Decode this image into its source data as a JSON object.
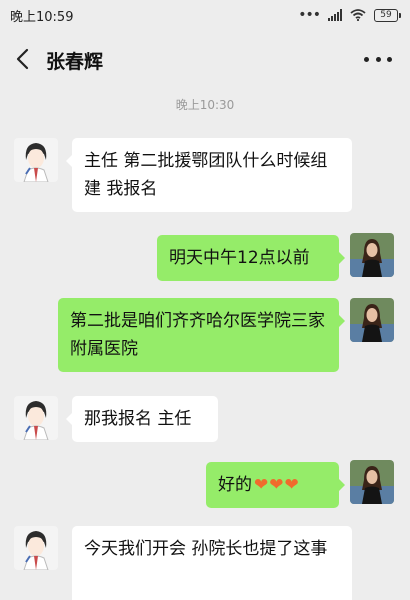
{
  "status_bar": {
    "time": "晚上10:59",
    "battery": "59",
    "icons": [
      "more-dots-icon",
      "signal-icon",
      "wifi-icon",
      "battery-icon"
    ]
  },
  "header": {
    "back_icon": "back-chevron-icon",
    "title": "张春辉",
    "more_icon": "more-horizontal-icon"
  },
  "timestamp": "晚上10:30",
  "colors": {
    "background": "#ededed",
    "bubble_self": "#95ec69",
    "bubble_other": "#ffffff",
    "timestamp": "#9a9a9a",
    "heart": "#f06b2c"
  },
  "messages": [
    {
      "side": "left",
      "text": "主任 第二批援鄂团队什么时候组建   我报名"
    },
    {
      "side": "right",
      "text": "明天中午12点以前"
    },
    {
      "side": "right",
      "text": "第二批是咱们齐齐哈尔医学院三家附属医院"
    },
    {
      "side": "left",
      "text": "那我报名  主任"
    },
    {
      "side": "right",
      "text": "好的",
      "emoji": "❤❤❤"
    },
    {
      "side": "left",
      "text": "今天我们开会  孙院长也提了这事"
    }
  ]
}
